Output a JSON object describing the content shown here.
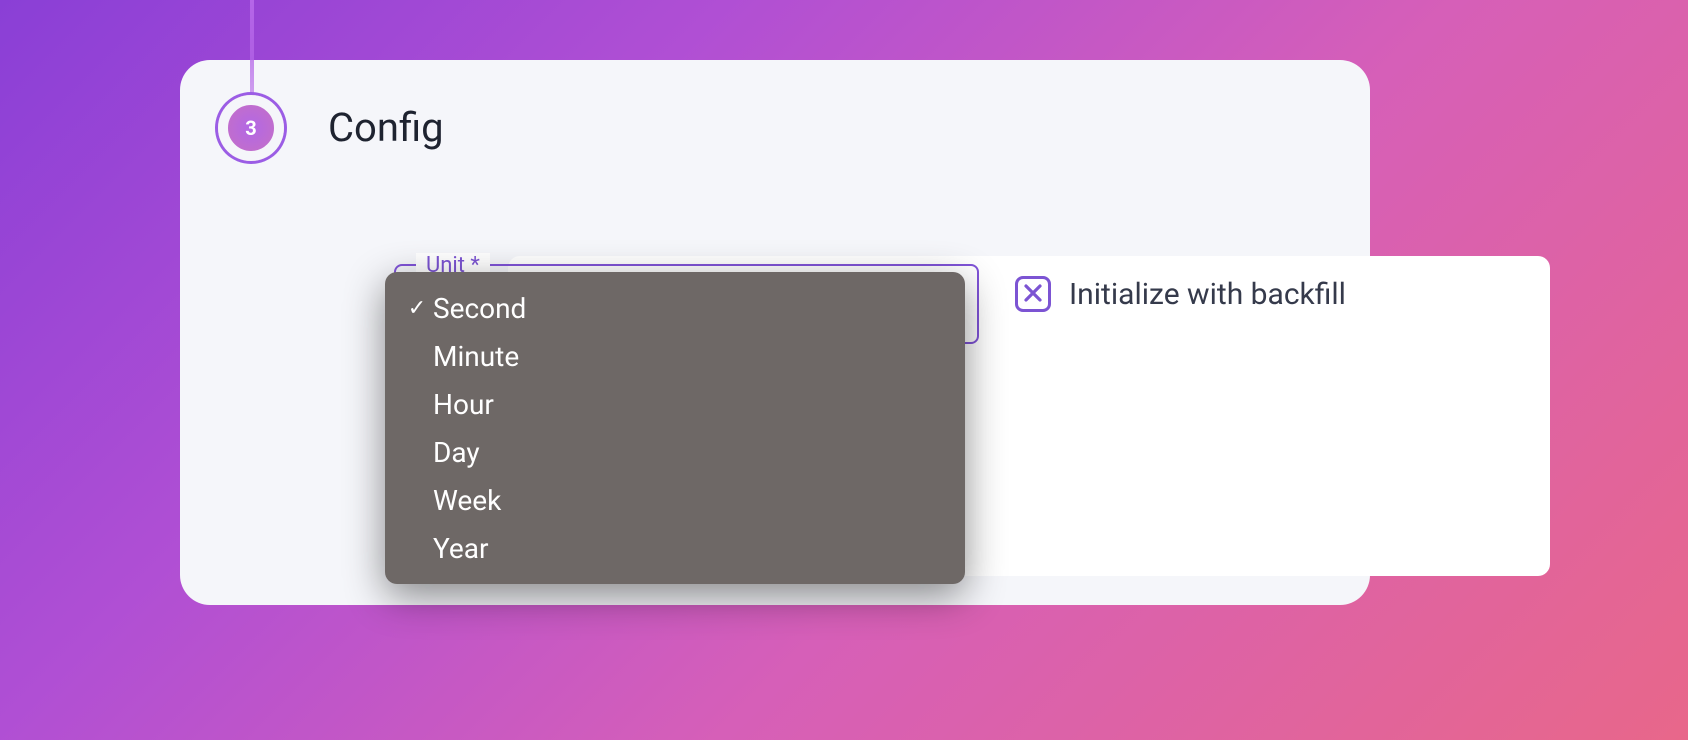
{
  "step": {
    "number": "3",
    "title": "Config"
  },
  "unit": {
    "label": "Unit *",
    "selected": "Second",
    "options": [
      {
        "label": "Second",
        "checked": true
      },
      {
        "label": "Minute",
        "checked": false
      },
      {
        "label": "Hour",
        "checked": false
      },
      {
        "label": "Day",
        "checked": false
      },
      {
        "label": "Week",
        "checked": false
      },
      {
        "label": "Year",
        "checked": false
      }
    ]
  },
  "backfill": {
    "label": "Initialize with backfill",
    "checked": true
  }
}
